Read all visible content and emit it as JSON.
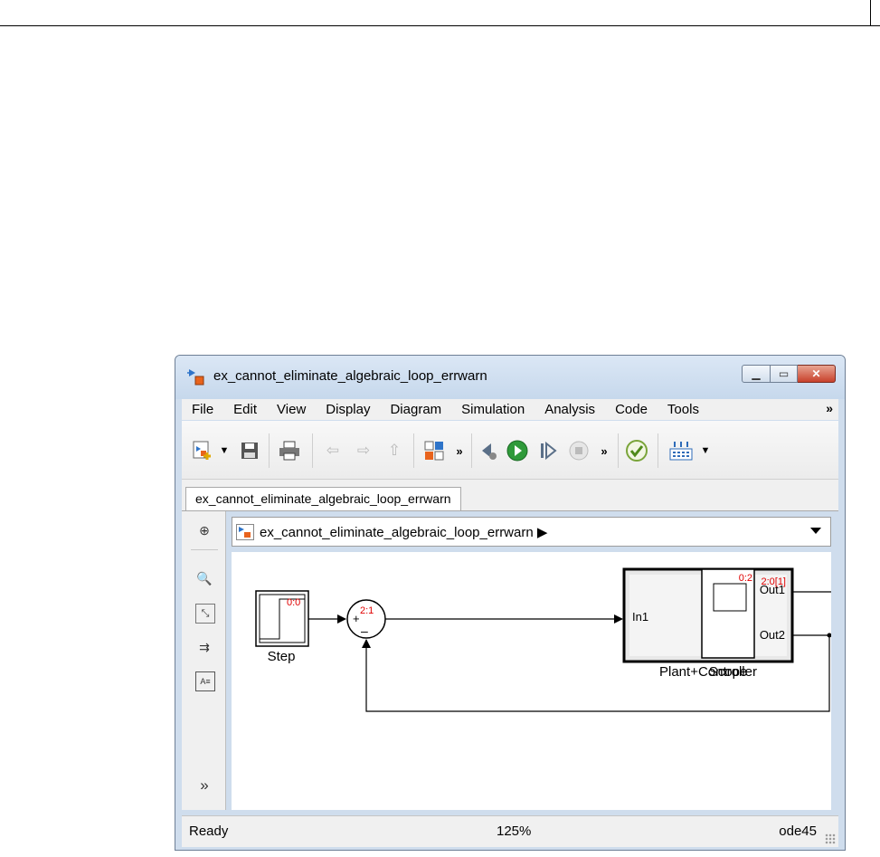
{
  "window": {
    "title": "ex_cannot_eliminate_algebraic_loop_errwarn",
    "buttons": [
      "minimize",
      "maximize",
      "close"
    ]
  },
  "menu": {
    "items": [
      "File",
      "Edit",
      "View",
      "Display",
      "Diagram",
      "Simulation",
      "Analysis",
      "Code",
      "Tools"
    ],
    "more": "»"
  },
  "toolbar": {
    "icons": [
      "new-model-icon",
      "save-icon",
      "print-icon",
      "back-icon",
      "forward-icon",
      "up-icon",
      "library-browser-icon",
      "step-back-icon",
      "run-icon",
      "step-forward-icon",
      "stop-icon",
      "model-advisor-icon",
      "build-icon"
    ],
    "more1": "»",
    "more2": "»",
    "more3": "»"
  },
  "tab": {
    "label": "ex_cannot_eliminate_algebraic_loop_errwarn"
  },
  "address": {
    "path": "ex_cannot_eliminate_algebraic_loop_errwarn ▶"
  },
  "leftpanel": {
    "icons": [
      "hide-browser-icon",
      "zoom-icon",
      "fit-view-icon",
      "signal-arrow-icon",
      "annotation-icon",
      "expand-icon"
    ],
    "expand": "»"
  },
  "diagram": {
    "blocks": {
      "step": {
        "name": "Step",
        "rate": "0:0"
      },
      "sum": {
        "plus": "+",
        "minus": "–",
        "rate": "2:1"
      },
      "plant": {
        "name": "Plant+Controller",
        "rate": "2:0[1]",
        "in1": "In1",
        "out1": "Out1",
        "out2": "Out2"
      },
      "scope": {
        "name": "Scope",
        "rate": "0:2"
      }
    }
  },
  "status": {
    "left": "Ready",
    "zoom": "125%",
    "solver": "ode45"
  },
  "colors": {
    "rate_label": "#e00000",
    "close_button": "#c8412b",
    "frame": "#cfdded"
  }
}
